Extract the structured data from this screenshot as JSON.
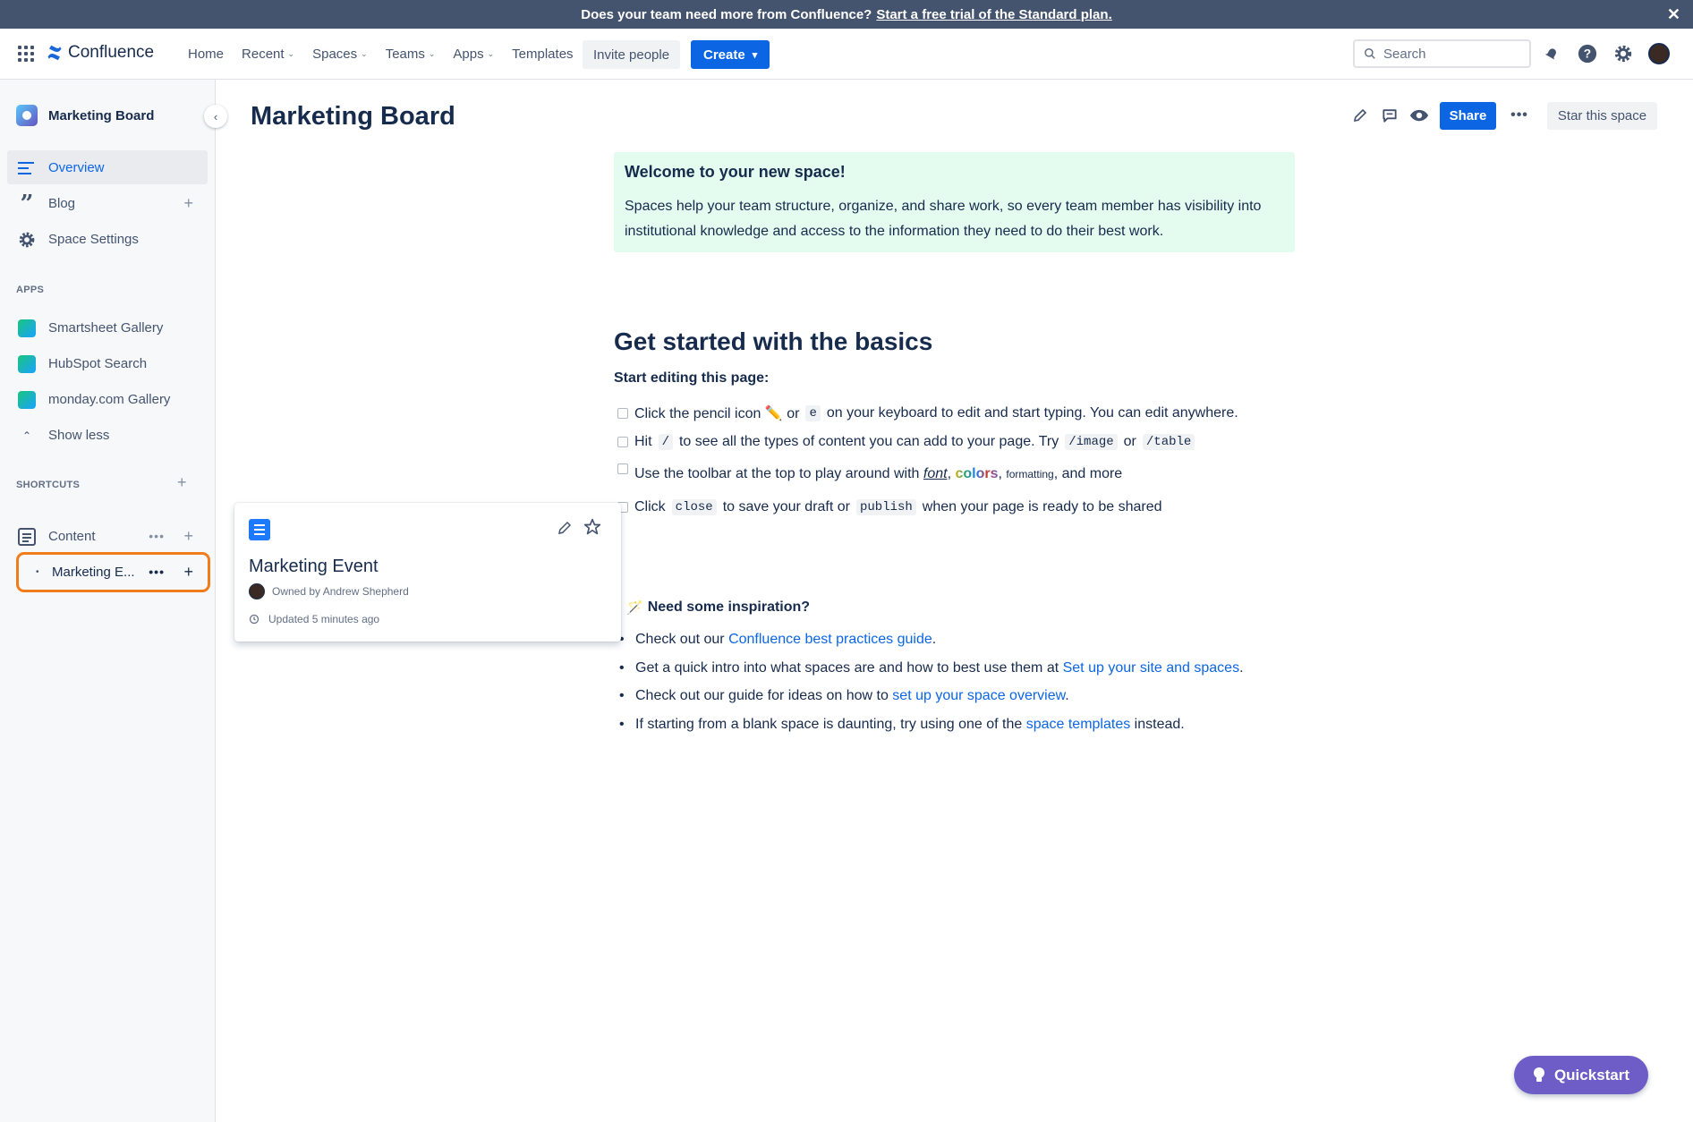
{
  "banner": {
    "text": "Does your team need more from Confluence?",
    "link": "Start a free trial of the Standard plan.",
    "close": "✕"
  },
  "topnav": {
    "logo": "Confluence",
    "items": [
      {
        "label": "Home"
      },
      {
        "label": "Recent"
      },
      {
        "label": "Spaces"
      },
      {
        "label": "Teams"
      },
      {
        "label": "Apps"
      },
      {
        "label": "Templates"
      }
    ],
    "invite": "Invite people",
    "create": "Create",
    "search_placeholder": "Search"
  },
  "sidebar": {
    "space_name": "Marketing Board",
    "items": [
      {
        "label": "Overview"
      },
      {
        "label": "Blog"
      },
      {
        "label": "Space Settings"
      }
    ],
    "apps_label": "APPS",
    "apps": [
      {
        "label": "Smartsheet Gallery"
      },
      {
        "label": "HubSpot Search"
      },
      {
        "label": "monday.com Gallery"
      }
    ],
    "show_less": "Show less",
    "shortcuts_label": "SHORTCUTS",
    "content_label": "Content",
    "tree_item": "Marketing E..."
  },
  "page": {
    "title": "Marketing Board",
    "share": "Share",
    "star": "Star this space",
    "welcome_title": "Welcome to your new space!",
    "welcome_body": "Spaces help your team structure, organize, and share work, so every team member has visibility into institutional knowledge and access to the information they need to do their best work.",
    "basics_heading": "Get started with the basics",
    "start_editing": "Start editing this page:",
    "tasks": {
      "t1a": "Click the pencil icon ✏️ or",
      "t1code": "e",
      "t1b": "on your keyboard to edit and start typing. You can edit anywhere.",
      "t2a": "Hit",
      "t2code": "/",
      "t2b": "to see all the types of content you can add to your page. Try",
      "t2code2": "/image",
      "t2c": "or",
      "t2code3": "/table",
      "t3a": "Use the toolbar at the top to play around with",
      "t3font": "font",
      "t3colors": "colors",
      "t3fmt1": "formatt",
      "t3fmt2": "ing",
      "t3b": ", and more",
      "t4a": "Click",
      "t4code": "close",
      "t4b": "to save your draft or",
      "t4code2": "publish",
      "t4c": "when your page is ready to be shared"
    },
    "inspiration": "Need some inspiration?",
    "bullets": {
      "b1a": "Check out our",
      "b1link": "Confluence best practices guide",
      "b1b": ".",
      "b2a": "Get a quick intro into what spaces are and how to best use them at",
      "b2link": "Set up your site and spaces",
      "b2b": ".",
      "b3a": "Check out our guide for ideas on how to",
      "b3link": "set up your space overview",
      "b3b": ".",
      "b4a": "If starting from a blank space is daunting, try using one of the",
      "b4link": "space templates",
      "b4b": "instead."
    }
  },
  "card": {
    "title": "Marketing Event",
    "owner": "Owned by Andrew Shepherd",
    "updated": "Updated 5 minutes ago"
  },
  "quickstart": "Quickstart",
  "colors": {
    "accent": "#0c66e4",
    "highlight": "#f07c1b",
    "quickstart": "#6e5dc6",
    "welcome_bg": "#e3fcef"
  }
}
